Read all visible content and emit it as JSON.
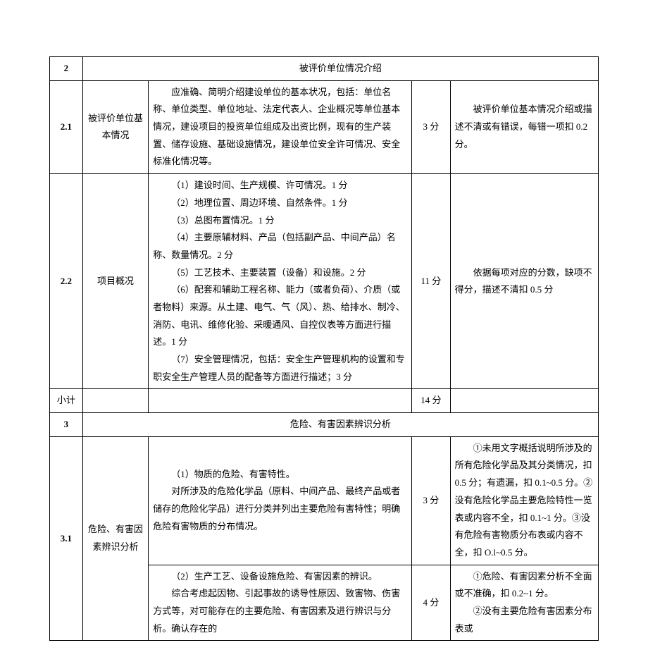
{
  "rows": {
    "r2": {
      "num": "2",
      "title": "被评价单位情况介绍"
    },
    "r2_1": {
      "num": "2.1",
      "item": "被评价单位基本情况",
      "desc": "应准确、简明介绍建设单位的基本状况，包括：单位名称、单位类型、单位地址、法定代表人、企业概况等单位基本情况，建设项目的投资单位组成及出资比例，现有的生产装置、储存设施、基础设施情况，建设单位安全许可情况、安全标准化情况等。",
      "score": "3 分",
      "note": "被评价单位基本情况介绍或描述不清或有错误，每错一项扣 0.2 分。"
    },
    "r2_2": {
      "num": "2.2",
      "item": "项目概况",
      "desc_lines": [
        "（1）建设时间、生产规模、许可情况。1 分",
        "（2）地理位置、周边环境、自然条件。1 分",
        "（3）总图布置情况。1 分",
        "（4）主要原辅材料、产品（包括副产品、中间产品）名称、数量情况。2 分",
        "（5）工艺技术、主要装置（设备）和设施。2 分",
        "（6）配套和辅助工程名称、能力（或者负荷）、介质（或者物料）来源。从土建、电气、气（风）、热、给排水、制冷、消防、电讯、维修化验、采暖通风、自控仪表等方面进行描述。1 分",
        "（7）安全管理情况，包括：安全生产管理机构的设置和专职安全生产管理人员的配备等方面进行描述；3 分"
      ],
      "score": "11 分",
      "note": "依据每项对应的分数，缺项不得分，描述不清扣 0.5 分"
    },
    "subtotal": {
      "label": "小计",
      "score": "14 分"
    },
    "r3": {
      "num": "3",
      "title": "危险、有害因素辨识分析"
    },
    "r3_1": {
      "num": "3.1",
      "item": "危险、有害因素辨识分析",
      "a_lines": [
        "（1）物质的危险、有害特性。",
        "对所涉及的危险化学品（原料、中间产品、最终产品或者储存的危险化学品）进行分类并列出主要危险有害特性；明确危险有害物质的分布情况。"
      ],
      "a_score": "3 分",
      "a_note": "①未用文字概括说明所涉及的所有危险化学品及其分类情况，扣 0.5 分；有遗漏，扣 0.1~0.5 分。②没有危险化学品主要危险特性一览表或内容不全，扣 0.1~1 分。③没有危险有害物质分布表或内容不全，扣 O.l~0.5 分。",
      "b_lines": [
        "（2）生产工艺、设备设施危险、有害因素的辨识。",
        "综合考虑起因物、引起事故的诱导性原因、致害物、伤害方式等，对可能存在的主要危险、有害因素及进行辨识与分析。确认存在的"
      ],
      "b_score": "4 分",
      "b_note_lines": [
        "①危险、有害因素分析不全面或不准确，扣 0.2~1 分。",
        "②没有主要危险有害因素分布表或"
      ]
    }
  }
}
